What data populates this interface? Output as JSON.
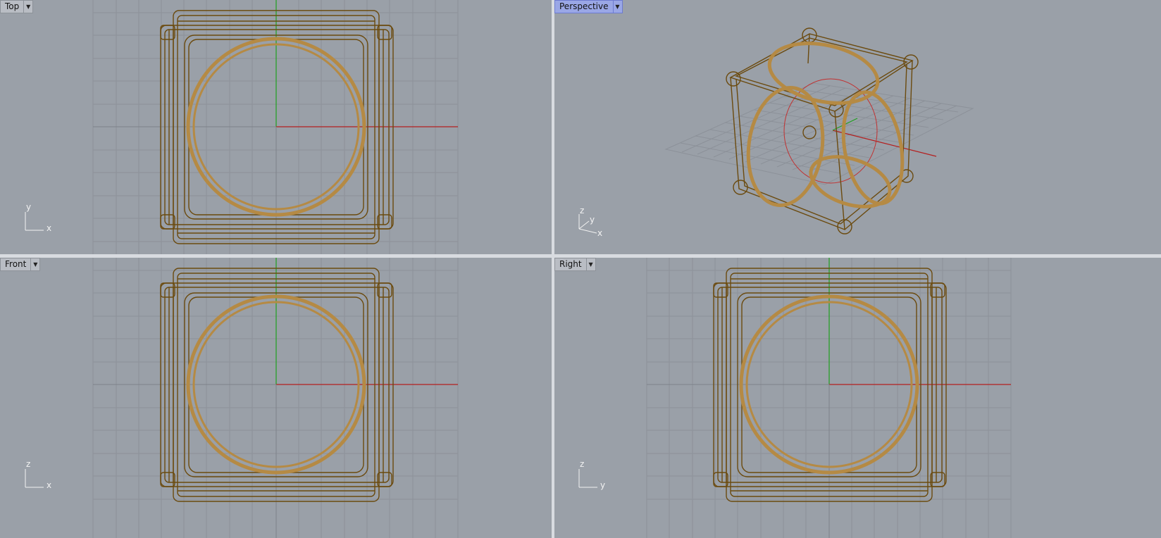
{
  "viewports": [
    {
      "id": "top",
      "label": "Top",
      "active": false,
      "axes": [
        "x",
        "y"
      ]
    },
    {
      "id": "perspective",
      "label": "Perspective",
      "active": true,
      "axes": [
        "z",
        "y",
        "x"
      ]
    },
    {
      "id": "front",
      "label": "Front",
      "active": false,
      "axes": [
        "x",
        "z"
      ]
    },
    {
      "id": "right",
      "label": "Right",
      "active": false,
      "axes": [
        "y",
        "z"
      ]
    }
  ],
  "icons": {
    "menu": "chevron-down-icon"
  },
  "colors": {
    "background": "#9aa0a8",
    "grid_minor": "#8c9199",
    "grid_major": "#7d828a",
    "x_axis": "#b41f1f",
    "y_axis": "#1fa01f",
    "object_wire": "#6b4a0e",
    "object_fill": "#b58a44"
  }
}
